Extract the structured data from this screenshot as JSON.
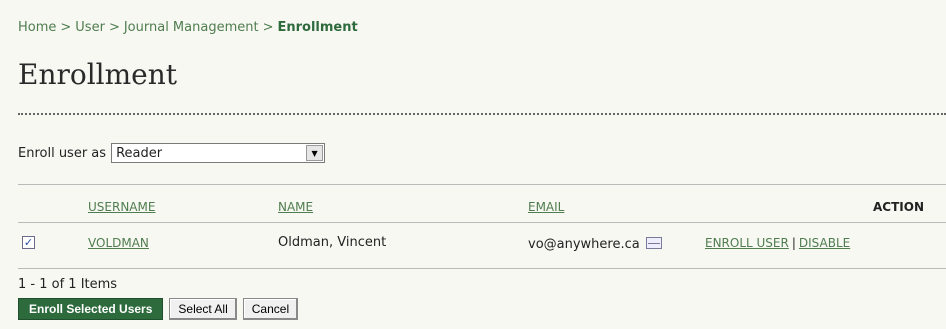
{
  "breadcrumb": {
    "items": [
      "Home",
      "User",
      "Journal Management"
    ],
    "separator": ">",
    "current": "Enrollment"
  },
  "page": {
    "title": "Enrollment"
  },
  "enroll_as": {
    "label": "Enroll user as",
    "selected": "Reader"
  },
  "table": {
    "headers": {
      "username": "USERNAME",
      "name": "NAME",
      "email": "EMAIL",
      "action": "ACTION"
    },
    "rows": [
      {
        "checked": true,
        "username": "VOLDMAN",
        "name": "Oldman, Vincent",
        "email": "vo@anywhere.ca",
        "actions": [
          "ENROLL USER",
          "DISABLE"
        ],
        "action_separator": "|"
      }
    ]
  },
  "pagination": {
    "summary": "1 - 1 of 1 Items"
  },
  "buttons": {
    "enroll_selected": "Enroll Selected Users",
    "select_all": "Select All",
    "cancel": "Cancel"
  },
  "colors": {
    "background": "#f8f8f3",
    "link": "#4f7d4f",
    "primary_button": "#2d6b3d"
  },
  "icons": {
    "email": "email-icon",
    "dropdown": "chevron-down-icon",
    "checkbox": "checkmark-icon"
  }
}
